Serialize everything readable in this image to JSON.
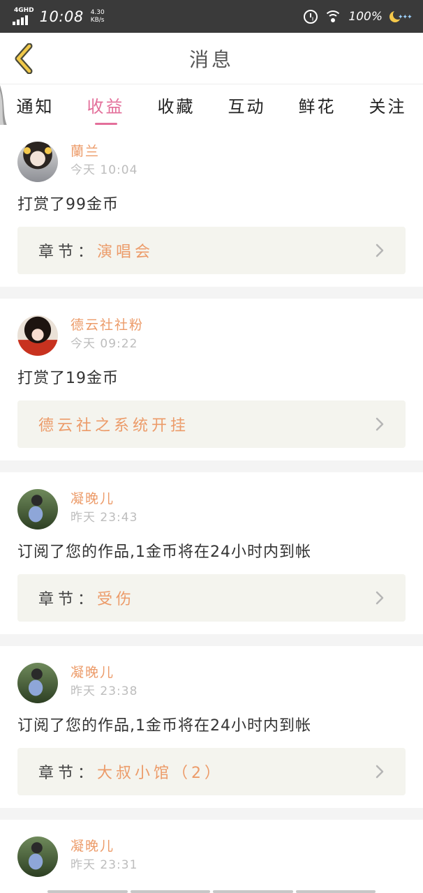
{
  "status_bar": {
    "network": "4GHD",
    "time": "10:08",
    "speed_value": "4.30",
    "speed_unit": "KB/s",
    "battery": "100%"
  },
  "header": {
    "title": "消息"
  },
  "tabs": [
    {
      "label": "通知",
      "active": false
    },
    {
      "label": "收益",
      "active": true
    },
    {
      "label": "收藏",
      "active": false
    },
    {
      "label": "互动",
      "active": false
    },
    {
      "label": "鲜花",
      "active": false
    },
    {
      "label": "关注",
      "active": false
    }
  ],
  "items": [
    {
      "user": "蘭兰",
      "time": "今天 10:04",
      "message": "打赏了99金币",
      "chapter_label": "章节：",
      "chapter": "演唱会"
    },
    {
      "user": "德云社社粉",
      "time": "今天 09:22",
      "message": "打赏了19金币",
      "chapter_label": "",
      "chapter": "德云社之系统开挂"
    },
    {
      "user": "凝晚儿",
      "time": "昨天 23:43",
      "message": "订阅了您的作品,1金币将在24小时内到帐",
      "chapter_label": "章节：",
      "chapter": "受伤"
    },
    {
      "user": "凝晚儿",
      "time": "昨天 23:38",
      "message": "订阅了您的作品,1金币将在24小时内到帐",
      "chapter_label": "章节：",
      "chapter": "大叔小馆（2）"
    },
    {
      "user": "凝晚儿",
      "time": "昨天 23:31"
    }
  ],
  "colors": {
    "accent_pink": "#e36f9a",
    "accent_orange": "#ec9b69",
    "status_bar": "#3a3a3a"
  }
}
